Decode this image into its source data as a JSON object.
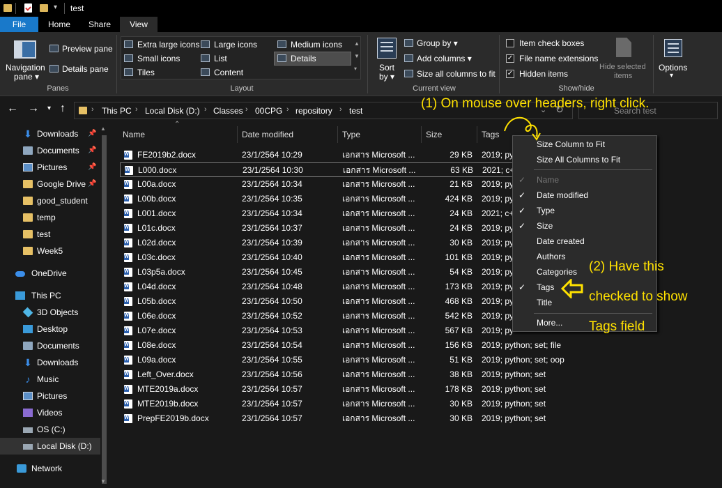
{
  "window": {
    "title": "test"
  },
  "ribbon_tabs": {
    "file": "File",
    "home": "Home",
    "share": "Share",
    "view": "View"
  },
  "panes": {
    "navigation_pane": "Navigation",
    "navigation_pane2": "pane ▾",
    "preview_pane": "Preview pane",
    "details_pane": "Details pane",
    "group_label": "Panes"
  },
  "layout": {
    "extra_large_icons": "Extra large icons",
    "large_icons": "Large icons",
    "medium_icons": "Medium icons",
    "small_icons": "Small icons",
    "list": "List",
    "details": "Details",
    "tiles": "Tiles",
    "content": "Content",
    "group_label": "Layout"
  },
  "current_view": {
    "sort_by": "Sort",
    "sort_by2": "by ▾",
    "group_by": "Group by ▾",
    "add_columns": "Add columns ▾",
    "size_all_columns": "Size all columns to fit",
    "group_label": "Current view"
  },
  "show_hide": {
    "item_check_boxes": "Item check boxes",
    "file_name_extensions": "File name extensions",
    "hidden_items": "Hidden items",
    "hide_selected": "Hide selected",
    "hide_selected2": "items",
    "group_label": "Show/hide",
    "checks": {
      "item_check_boxes": "",
      "file_name_extensions": "✓",
      "hidden_items": "✓"
    }
  },
  "options": {
    "label": "Options",
    "arrow": "▾"
  },
  "breadcrumb": [
    "This PC",
    "Local Disk (D:)",
    "Classes",
    "00CPG",
    "repository",
    "test"
  ],
  "search": {
    "placeholder": "Search test"
  },
  "sidebar": {
    "quick_access": [
      {
        "label": "Downloads",
        "icon": "download-icon",
        "pinned": true
      },
      {
        "label": "Documents",
        "icon": "documents-icon",
        "pinned": true
      },
      {
        "label": "Pictures",
        "icon": "pictures-icon",
        "pinned": true
      },
      {
        "label": "Google Drive",
        "icon": "folder-icon",
        "pinned": true
      },
      {
        "label": "good_student",
        "icon": "folder-icon",
        "pinned": false
      },
      {
        "label": "temp",
        "icon": "folder-icon",
        "pinned": false
      },
      {
        "label": "test",
        "icon": "folder-icon",
        "pinned": false
      },
      {
        "label": "Week5",
        "icon": "folder-icon",
        "pinned": false
      }
    ],
    "onedrive": "OneDrive",
    "this_pc": "This PC",
    "pc_items": [
      {
        "label": "3D Objects",
        "icon": "3d-objects-icon"
      },
      {
        "label": "Desktop",
        "icon": "desktop-icon"
      },
      {
        "label": "Documents",
        "icon": "documents-icon"
      },
      {
        "label": "Downloads",
        "icon": "download-icon"
      },
      {
        "label": "Music",
        "icon": "music-icon"
      },
      {
        "label": "Pictures",
        "icon": "pictures-icon"
      },
      {
        "label": "Videos",
        "icon": "videos-icon"
      },
      {
        "label": "OS (C:)",
        "icon": "drive-icon"
      },
      {
        "label": "Local Disk (D:)",
        "icon": "drive-icon"
      }
    ],
    "network": "Network"
  },
  "columns": {
    "name": "Name",
    "date": "Date modified",
    "type": "Type",
    "size": "Size",
    "tags": "Tags"
  },
  "files": [
    {
      "name": "FE2019b2.docx",
      "date": "23/1/2564 10:29",
      "type": "เอกสาร Microsoft ...",
      "size": "29 KB",
      "tags": "2019; py"
    },
    {
      "name": "L000.docx",
      "date": "23/1/2564 10:30",
      "type": "เอกสาร Microsoft ...",
      "size": "63 KB",
      "tags": "2021; c+"
    },
    {
      "name": "L00a.docx",
      "date": "23/1/2564 10:34",
      "type": "เอกสาร Microsoft ...",
      "size": "21 KB",
      "tags": "2019; py"
    },
    {
      "name": "L00b.docx",
      "date": "23/1/2564 10:35",
      "type": "เอกสาร Microsoft ...",
      "size": "424 KB",
      "tags": "2019; py"
    },
    {
      "name": "L001.docx",
      "date": "23/1/2564 10:34",
      "type": "เอกสาร Microsoft ...",
      "size": "24 KB",
      "tags": "2021; c+"
    },
    {
      "name": "L01c.docx",
      "date": "23/1/2564 10:37",
      "type": "เอกสาร Microsoft ...",
      "size": "24 KB",
      "tags": "2019; py"
    },
    {
      "name": "L02d.docx",
      "date": "23/1/2564 10:39",
      "type": "เอกสาร Microsoft ...",
      "size": "30 KB",
      "tags": "2019; py"
    },
    {
      "name": "L03c.docx",
      "date": "23/1/2564 10:40",
      "type": "เอกสาร Microsoft ...",
      "size": "101 KB",
      "tags": "2019; py"
    },
    {
      "name": "L03p5a.docx",
      "date": "23/1/2564 10:45",
      "type": "เอกสาร Microsoft ...",
      "size": "54 KB",
      "tags": "2019; py"
    },
    {
      "name": "L04d.docx",
      "date": "23/1/2564 10:48",
      "type": "เอกสาร Microsoft ...",
      "size": "173 KB",
      "tags": "2019; py"
    },
    {
      "name": "L05b.docx",
      "date": "23/1/2564 10:50",
      "type": "เอกสาร Microsoft ...",
      "size": "468 KB",
      "tags": "2019; py"
    },
    {
      "name": "L06e.docx",
      "date": "23/1/2564 10:52",
      "type": "เอกสาร Microsoft ...",
      "size": "542 KB",
      "tags": "2019; py"
    },
    {
      "name": "L07e.docx",
      "date": "23/1/2564 10:53",
      "type": "เอกสาร Microsoft ...",
      "size": "567 KB",
      "tags": "2019; py"
    },
    {
      "name": "L08e.docx",
      "date": "23/1/2564 10:54",
      "type": "เอกสาร Microsoft ...",
      "size": "156 KB",
      "tags": "2019; python; set; file"
    },
    {
      "name": "L09a.docx",
      "date": "23/1/2564 10:55",
      "type": "เอกสาร Microsoft ...",
      "size": "51 KB",
      "tags": "2019; python; set; oop"
    },
    {
      "name": "Left_Over.docx",
      "date": "23/1/2564 10:56",
      "type": "เอกสาร Microsoft ...",
      "size": "38 KB",
      "tags": "2019; python; set"
    },
    {
      "name": "MTE2019a.docx",
      "date": "23/1/2564 10:57",
      "type": "เอกสาร Microsoft ...",
      "size": "178 KB",
      "tags": "2019; python; set"
    },
    {
      "name": "MTE2019b.docx",
      "date": "23/1/2564 10:57",
      "type": "เอกสาร Microsoft ...",
      "size": "30 KB",
      "tags": "2019; python; set"
    },
    {
      "name": "PrepFE2019b.docx",
      "date": "23/1/2564 10:57",
      "type": "เอกสาร Microsoft ...",
      "size": "30 KB",
      "tags": "2019; python; set"
    }
  ],
  "context_menu": {
    "size_column": "Size Column to Fit",
    "size_all": "Size All Columns to Fit",
    "items": [
      {
        "label": "Name",
        "checked": true,
        "disabled": true
      },
      {
        "label": "Date modified",
        "checked": true,
        "disabled": false
      },
      {
        "label": "Type",
        "checked": true,
        "disabled": false
      },
      {
        "label": "Size",
        "checked": true,
        "disabled": false
      },
      {
        "label": "Date created",
        "checked": false,
        "disabled": false
      },
      {
        "label": "Authors",
        "checked": false,
        "disabled": false
      },
      {
        "label": "Categories",
        "checked": false,
        "disabled": false
      },
      {
        "label": "Tags",
        "checked": true,
        "disabled": false
      },
      {
        "label": "Title",
        "checked": false,
        "disabled": false
      }
    ],
    "more": "More..."
  },
  "annotations": {
    "step1": "(1) On mouse over headers, right click.",
    "step2_line1": "(2) Have this",
    "step2_line2": "checked to show",
    "step2_line3": "Tags field"
  },
  "colors": {
    "accent": "#1979ca",
    "annotation": "#ffe100",
    "folder": "#e6c065"
  }
}
